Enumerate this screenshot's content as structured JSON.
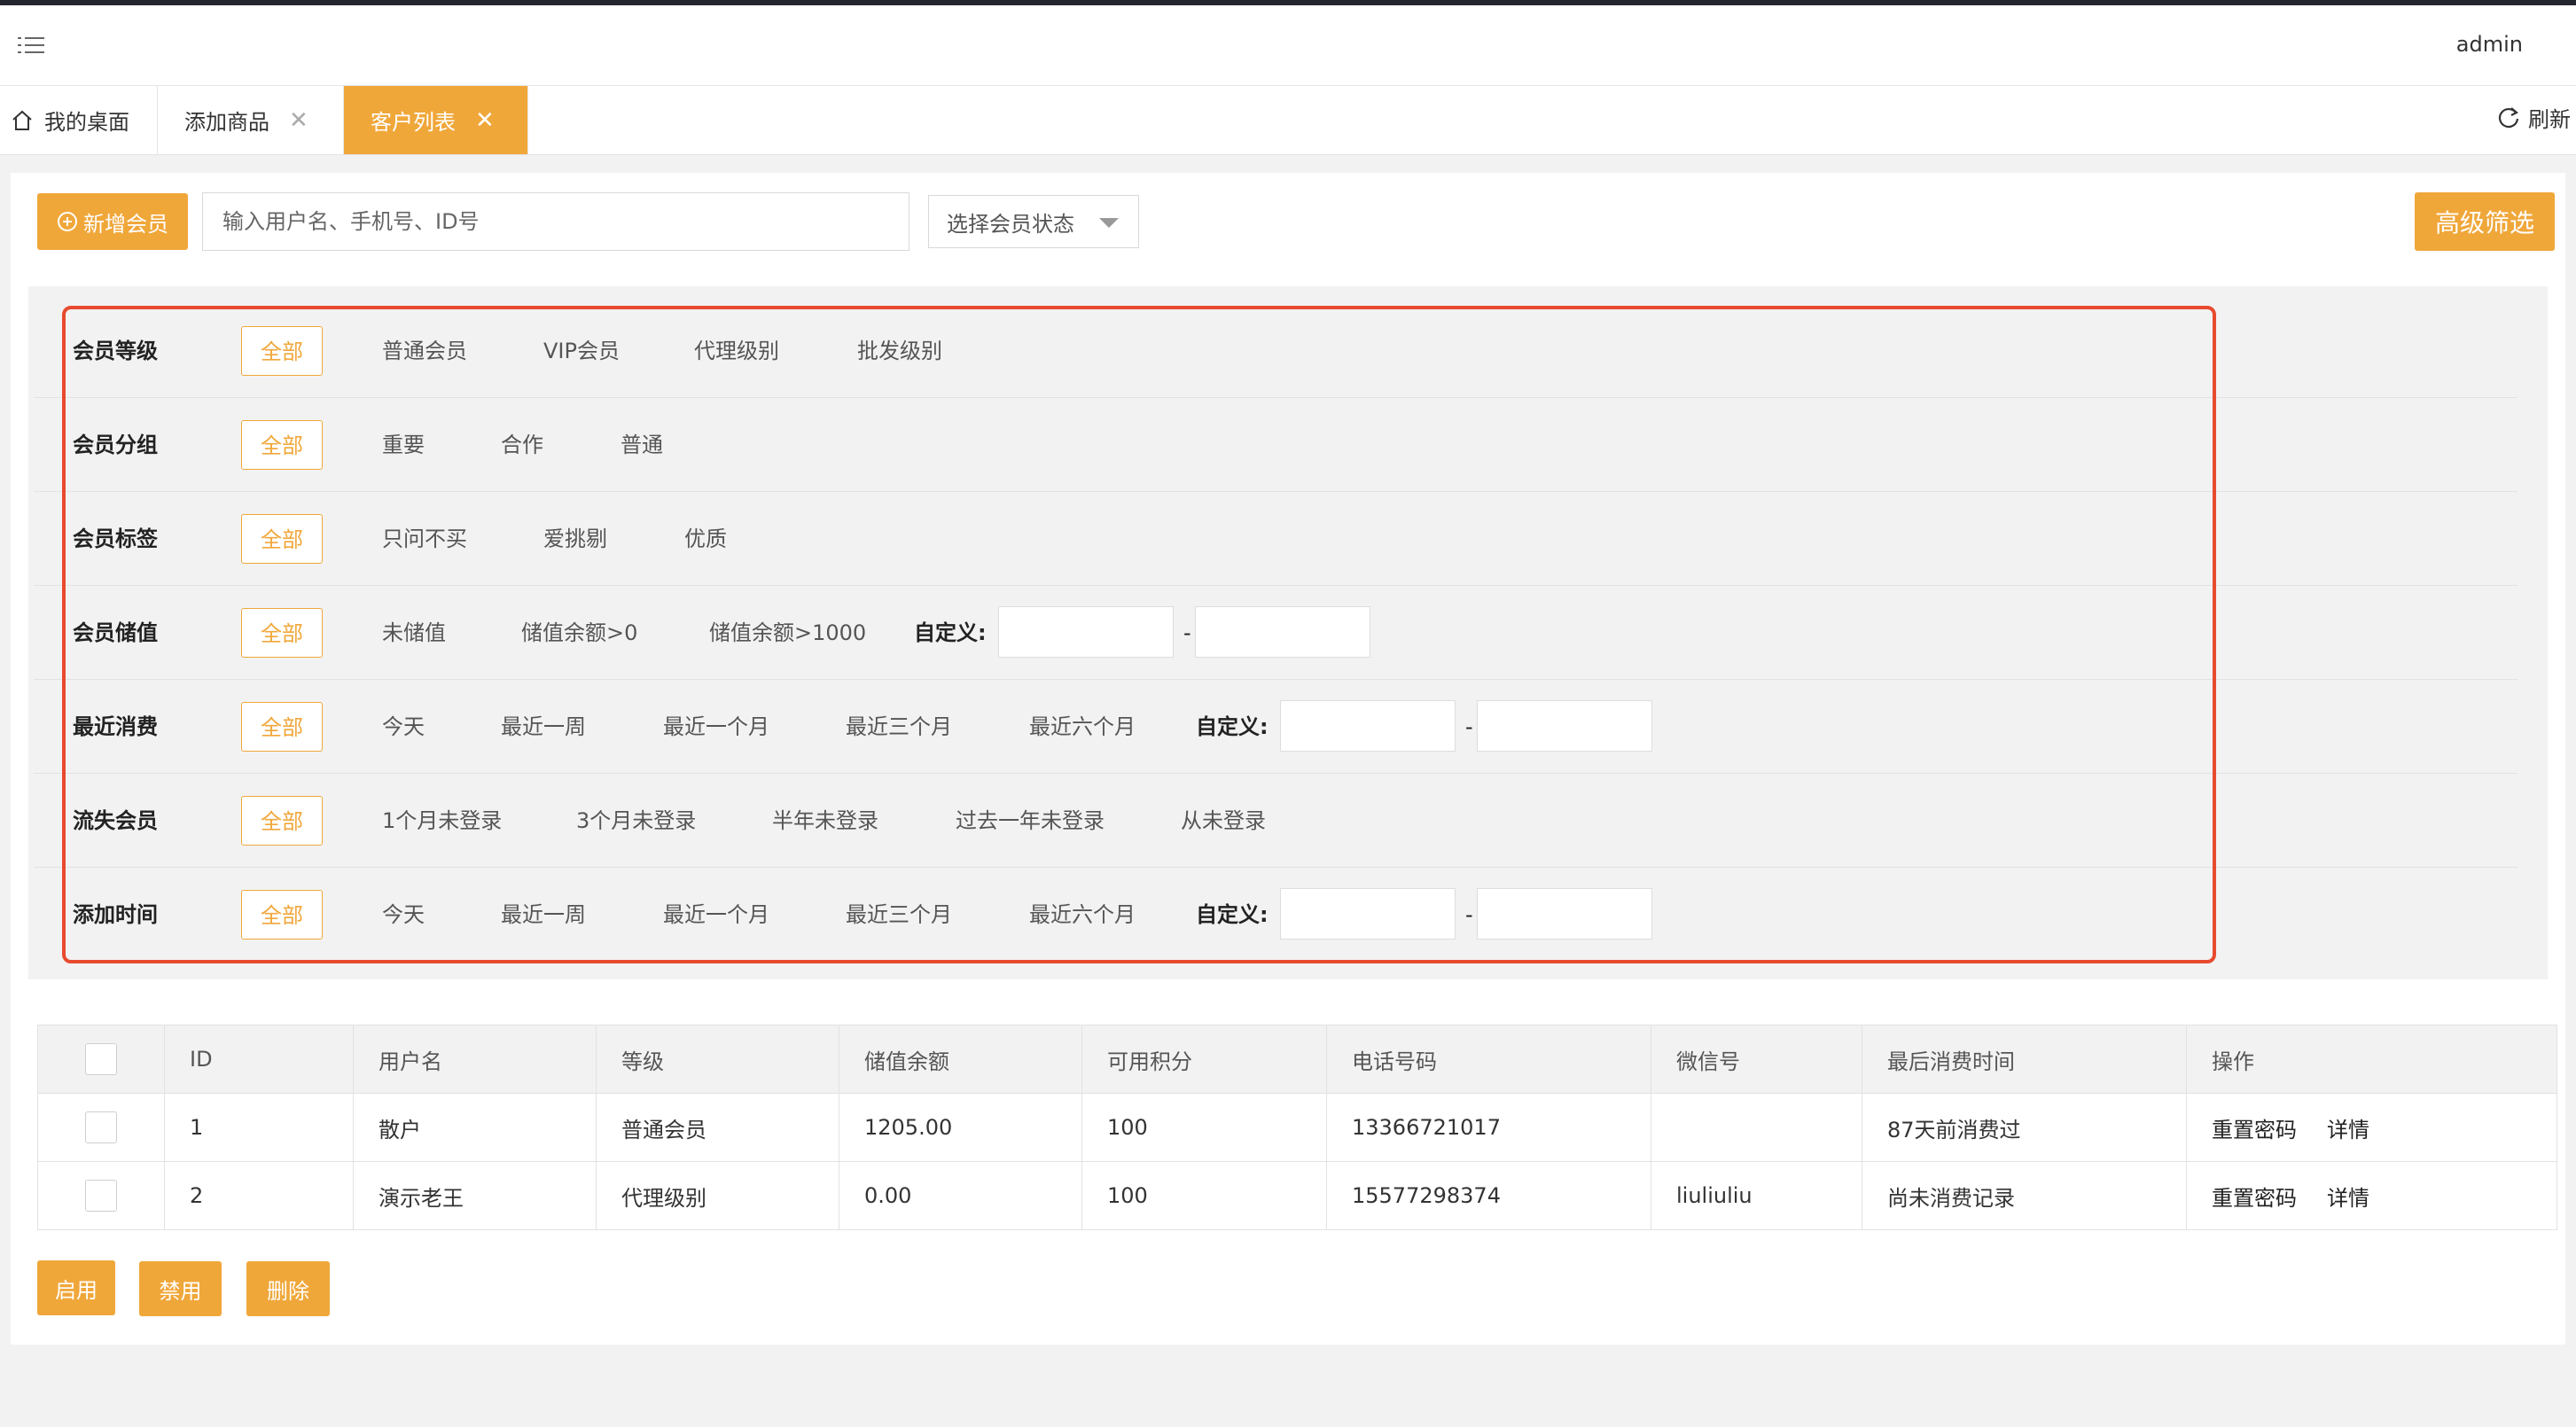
{
  "header": {
    "user": "admin"
  },
  "tabs": [
    {
      "label": "我的桌面"
    },
    {
      "label": "添加商品"
    },
    {
      "label": "客户列表"
    }
  ],
  "refresh_label": "刷新",
  "toolbar": {
    "add_member": "新增会员",
    "search_placeholder": "输入用户名、手机号、ID号",
    "status_select": "选择会员状态",
    "advanced_filter": "高级筛选"
  },
  "filters": {
    "all_label": "全部",
    "custom_label": "自定义:",
    "range_sep": "-",
    "level": {
      "label": "会员等级",
      "options": [
        "普通会员",
        "VIP会员",
        "代理级别",
        "批发级别"
      ]
    },
    "group": {
      "label": "会员分组",
      "options": [
        "重要",
        "合作",
        "普通"
      ]
    },
    "tag": {
      "label": "会员标签",
      "options": [
        "只问不买",
        "爱挑剔",
        "优质"
      ]
    },
    "stored": {
      "label": "会员储值",
      "options": [
        "未储值",
        "储值余额>0",
        "储值余额>1000"
      ]
    },
    "recent": {
      "label": "最近消费",
      "options": [
        "今天",
        "最近一周",
        "最近一个月",
        "最近三个月",
        "最近六个月"
      ]
    },
    "lost": {
      "label": "流失会员",
      "options": [
        "1个月未登录",
        "3个月未登录",
        "半年未登录",
        "过去一年未登录",
        "从未登录"
      ]
    },
    "added": {
      "label": "添加时间",
      "options": [
        "今天",
        "最近一周",
        "最近一个月",
        "最近三个月",
        "最近六个月"
      ]
    }
  },
  "table": {
    "headers": [
      "ID",
      "用户名",
      "等级",
      "储值余额",
      "可用积分",
      "电话号码",
      "微信号",
      "最后消费时间",
      "操作"
    ],
    "rows": [
      {
        "id": "1",
        "username": "散户",
        "level": "普通会员",
        "balance": "1205.00",
        "points": "100",
        "phone": "13366721017",
        "wechat": "",
        "last": "87天前消费过"
      },
      {
        "id": "2",
        "username": "演示老王",
        "level": "代理级别",
        "balance": "0.00",
        "points": "100",
        "phone": "15577298374",
        "wechat": "liuliuliu",
        "last": "尚未消费记录"
      }
    ],
    "actions": {
      "reset": "重置密码",
      "detail": "详情"
    }
  },
  "bottom_buttons": {
    "enable": "启用",
    "disable": "禁用",
    "delete": "删除"
  },
  "colors": {
    "accent": "#f0a73a",
    "highlight_border": "#e84a2f"
  }
}
